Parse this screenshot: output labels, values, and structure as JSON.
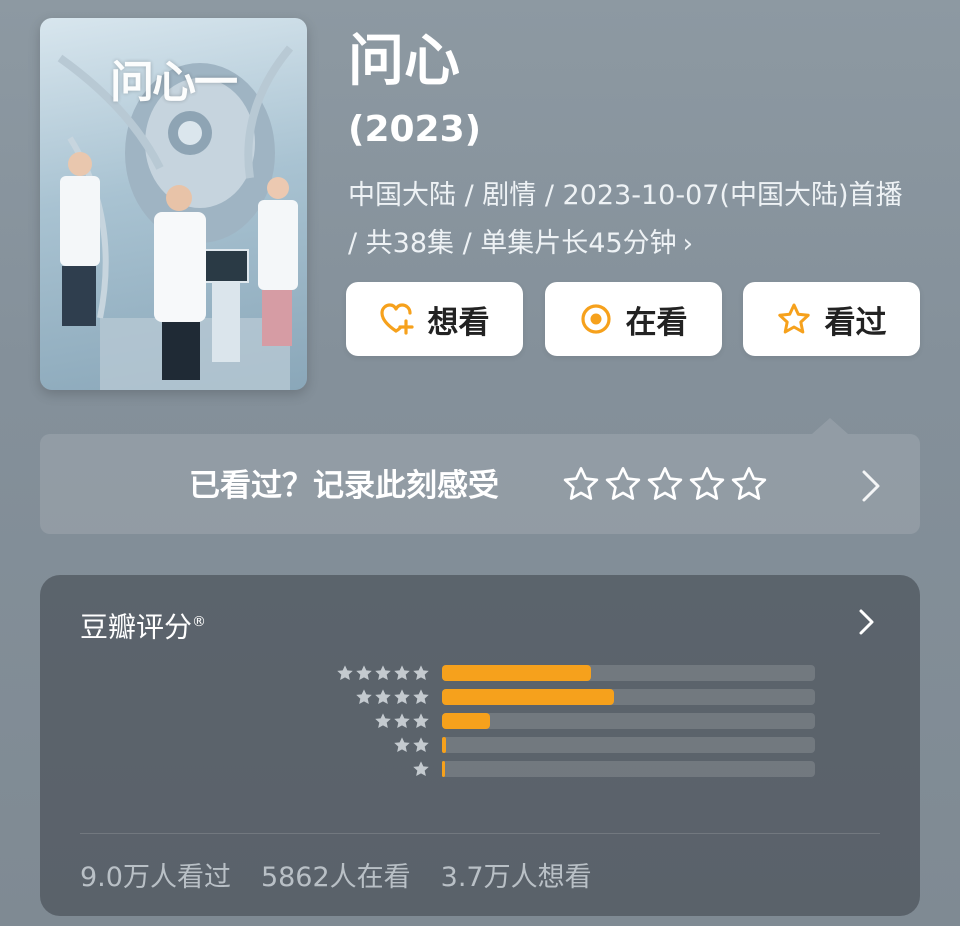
{
  "movie": {
    "poster_logo": "问心一",
    "title": "问心",
    "year": "(2023)",
    "meta": "中国大陆 / 剧情 / 2023-10-07(中国大陆)首播 / 共38集 / 单集片长45分钟",
    "meta_chevron": "›"
  },
  "actions": {
    "want_label": "想看",
    "watching_label": "在看",
    "watched_label": "看过",
    "accent": "#f6a11c"
  },
  "rate_prompt": {
    "text": "已看过？记录此刻感受",
    "star_count": 5
  },
  "score": {
    "title": "豆瓣评分",
    "title_mark": "®",
    "distribution": [
      {
        "stars": 5,
        "fraction": 0.4
      },
      {
        "stars": 4,
        "fraction": 0.46
      },
      {
        "stars": 3,
        "fraction": 0.13
      },
      {
        "stars": 2,
        "fraction": 0.01
      },
      {
        "stars": 1,
        "fraction": 0.005
      }
    ],
    "stats": {
      "watched": "9.0万人看过",
      "watching": "5862人在看",
      "want": "3.7万人想看"
    }
  }
}
